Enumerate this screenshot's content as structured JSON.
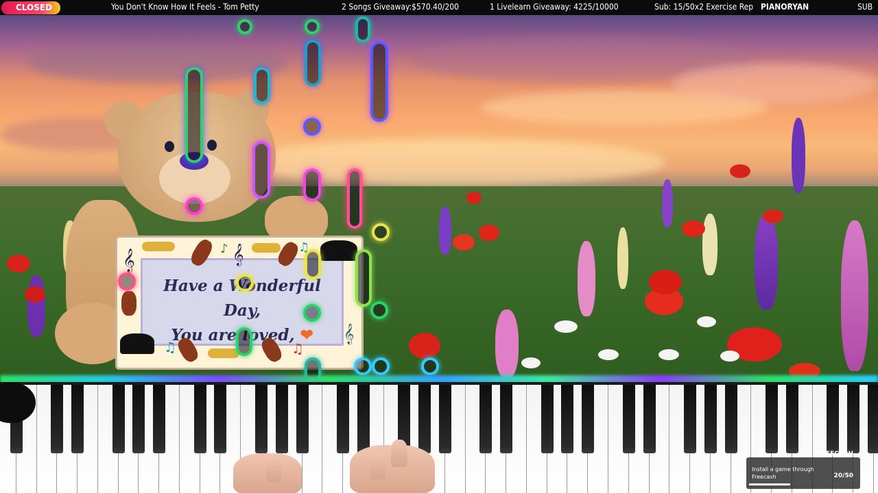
{
  "topbar": {
    "status_badge": "CLOSED",
    "song_title": "You Don't Know How It Feels - Tom Petty",
    "songs_giveaway": "2 Songs Giveaway:$570.40/200",
    "livelearn_giveaway": "1 Livelearn Giveaway: 4225/10000",
    "sub_goal": "Sub: 15/50x2 Exercise Rep",
    "channel": "PIANORYAN",
    "sub_label": "SUB"
  },
  "sign": {
    "line1": "Have a Wonderful Day,",
    "line2": "You are loved,",
    "heart": "❤"
  },
  "freecash": {
    "brand": "FREECASH",
    "message": "Install a game through Freecash",
    "progress_text": "20/50",
    "progress": 0.4
  },
  "colors": {
    "note_green": "#2bd16a",
    "note_teal": "#1fb7a6",
    "note_blue": "#3e6bff",
    "note_purple": "#a84bff",
    "note_pink": "#ff3fd0",
    "note_yellow": "#e9e34a",
    "badge_red": "#e5194f"
  }
}
